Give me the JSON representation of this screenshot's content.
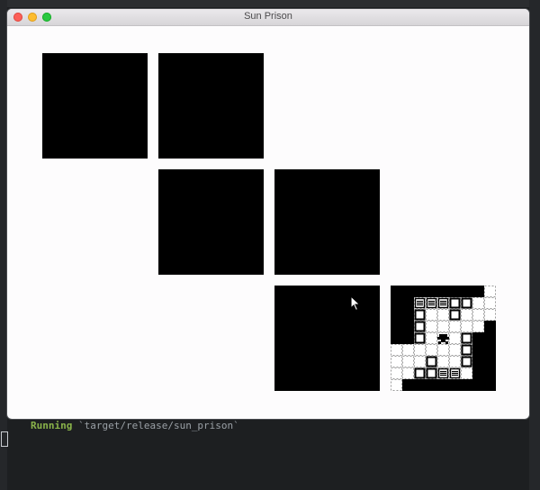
{
  "window": {
    "title": "Sun Prison"
  },
  "levels": [
    {
      "id": 1,
      "state": "locked"
    },
    {
      "id": 2,
      "state": "locked"
    },
    {
      "id": 3,
      "state": "locked"
    },
    {
      "id": 4,
      "state": "locked"
    },
    {
      "id": 5,
      "state": "locked"
    },
    {
      "id": 6,
      "state": "unlocked"
    }
  ],
  "terminal": {
    "status": "Running",
    "command": "`target/release/sun_prison`"
  },
  "icons": {
    "close": "close-traffic-light",
    "minimize": "minimize-traffic-light",
    "maximize": "maximize-traffic-light",
    "pointer": "mouse-pointer-icon",
    "player": "player-sprite-icon",
    "crate": "crate-icon",
    "goal": "striped-goal-icon"
  },
  "colors": {
    "tile": "#000000",
    "window_bg": "#fdfcfd",
    "terminal_running": "#8ab34a"
  }
}
